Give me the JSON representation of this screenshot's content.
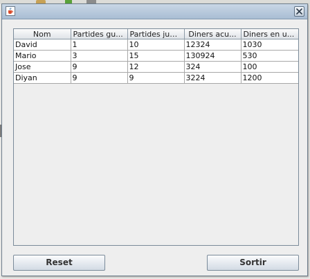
{
  "window": {
    "title": ""
  },
  "table": {
    "columns": [
      "Nom",
      "Partides gu...",
      "Partides jug...",
      "Diners acu...",
      "Diners en u..."
    ],
    "rows": [
      [
        "David",
        "1",
        "10",
        "12324",
        "1030"
      ],
      [
        "Mario",
        "3",
        "15",
        "130924",
        "530"
      ],
      [
        "Jose",
        "9",
        "12",
        "324",
        "100"
      ],
      [
        "Diyan",
        "9",
        "9",
        "3224",
        "1200"
      ]
    ]
  },
  "buttons": {
    "reset": "Reset",
    "sortir": "Sortir"
  },
  "icons": {
    "app": "java-cup-icon",
    "close": "close-icon"
  },
  "colors": {
    "titlebar": "#b9cadd",
    "window_bg": "#eeeeee",
    "table_bg": "#ffffff"
  }
}
